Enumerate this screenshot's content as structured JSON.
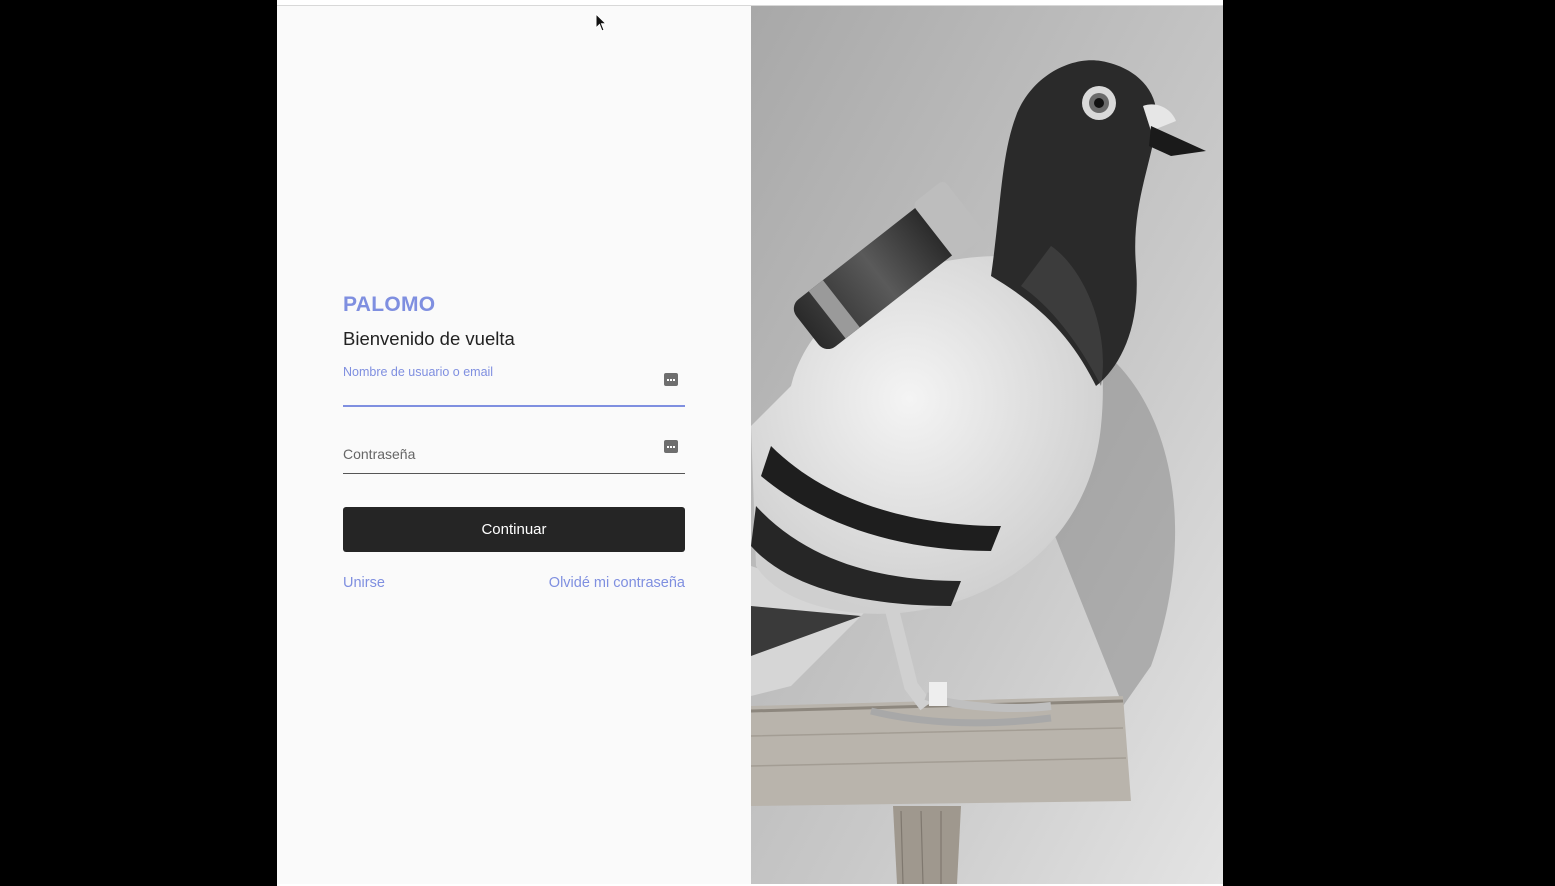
{
  "colors": {
    "accent": "#7f8fe0",
    "button_bg": "#252525",
    "button_text": "#ffffff"
  },
  "login": {
    "brand": "PALOMO",
    "heading": "Bienvenido de vuelta",
    "username": {
      "label": "Nombre de usuario o email",
      "value": "",
      "icon": "password-manager-key-icon"
    },
    "password": {
      "placeholder": "Contraseña",
      "value": "",
      "icon": "password-manager-key-icon"
    },
    "continue_label": "Continuar",
    "join_link": "Unirse",
    "forgot_link": "Olvidé mi contraseña"
  },
  "hero_image": {
    "subject": "black-and-white photo of a carrier pigeon with a message tube on a wooden stand"
  }
}
